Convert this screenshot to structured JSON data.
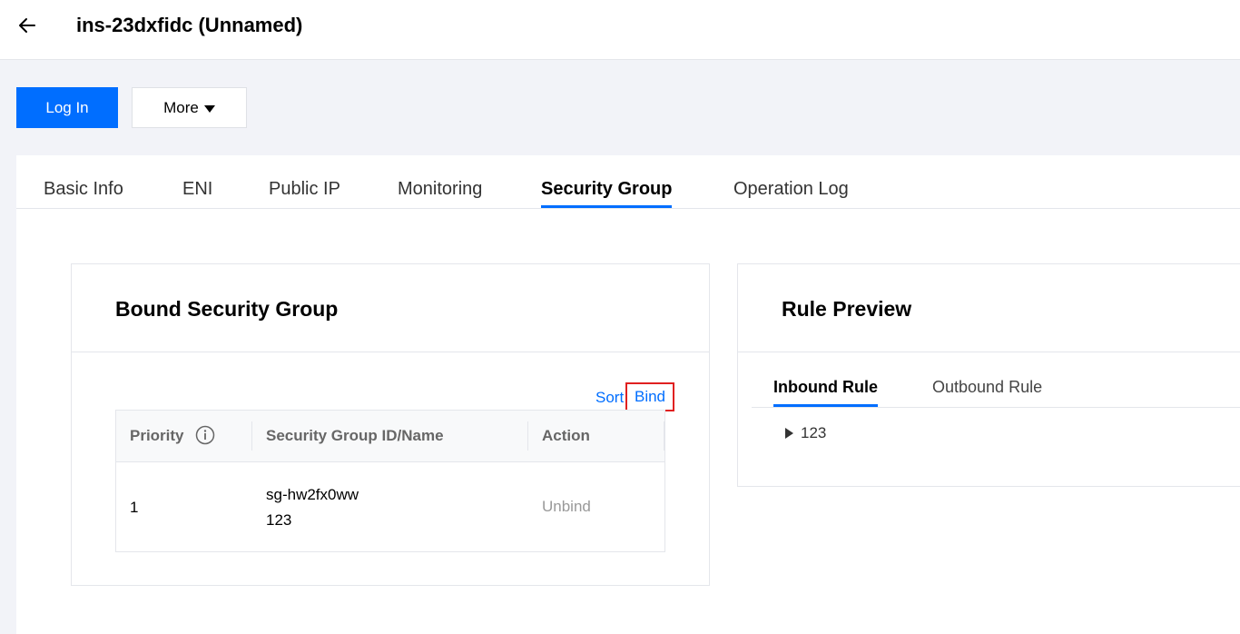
{
  "header": {
    "title": "ins-23dxfidc (Unnamed)"
  },
  "actions": {
    "login_label": "Log In",
    "more_label": "More"
  },
  "tabs": [
    {
      "label": "Basic Info"
    },
    {
      "label": "ENI"
    },
    {
      "label": "Public IP"
    },
    {
      "label": "Monitoring"
    },
    {
      "label": "Security Group",
      "active": true
    },
    {
      "label": "Operation Log"
    }
  ],
  "bound_card": {
    "title": "Bound Security Group",
    "sort_label": "Sort",
    "bind_label": "Bind",
    "table": {
      "headers": [
        "Priority",
        "Security Group ID/Name",
        "Action"
      ],
      "rows": [
        {
          "priority": "1",
          "sg_id": "sg-hw2fx0ww",
          "sg_name": "123",
          "action": "Unbind"
        }
      ]
    }
  },
  "preview_card": {
    "title": "Rule Preview",
    "subtabs": [
      {
        "label": "Inbound Rule",
        "active": true
      },
      {
        "label": "Outbound Rule"
      }
    ],
    "rules": [
      {
        "name": "123"
      }
    ]
  },
  "colors": {
    "accent": "#006eff",
    "highlight_border": "#e02020",
    "background": "#f2f3f8"
  },
  "icons": [
    "back-arrow-icon",
    "caret-down-icon",
    "info-icon",
    "triangle-right-icon"
  ]
}
